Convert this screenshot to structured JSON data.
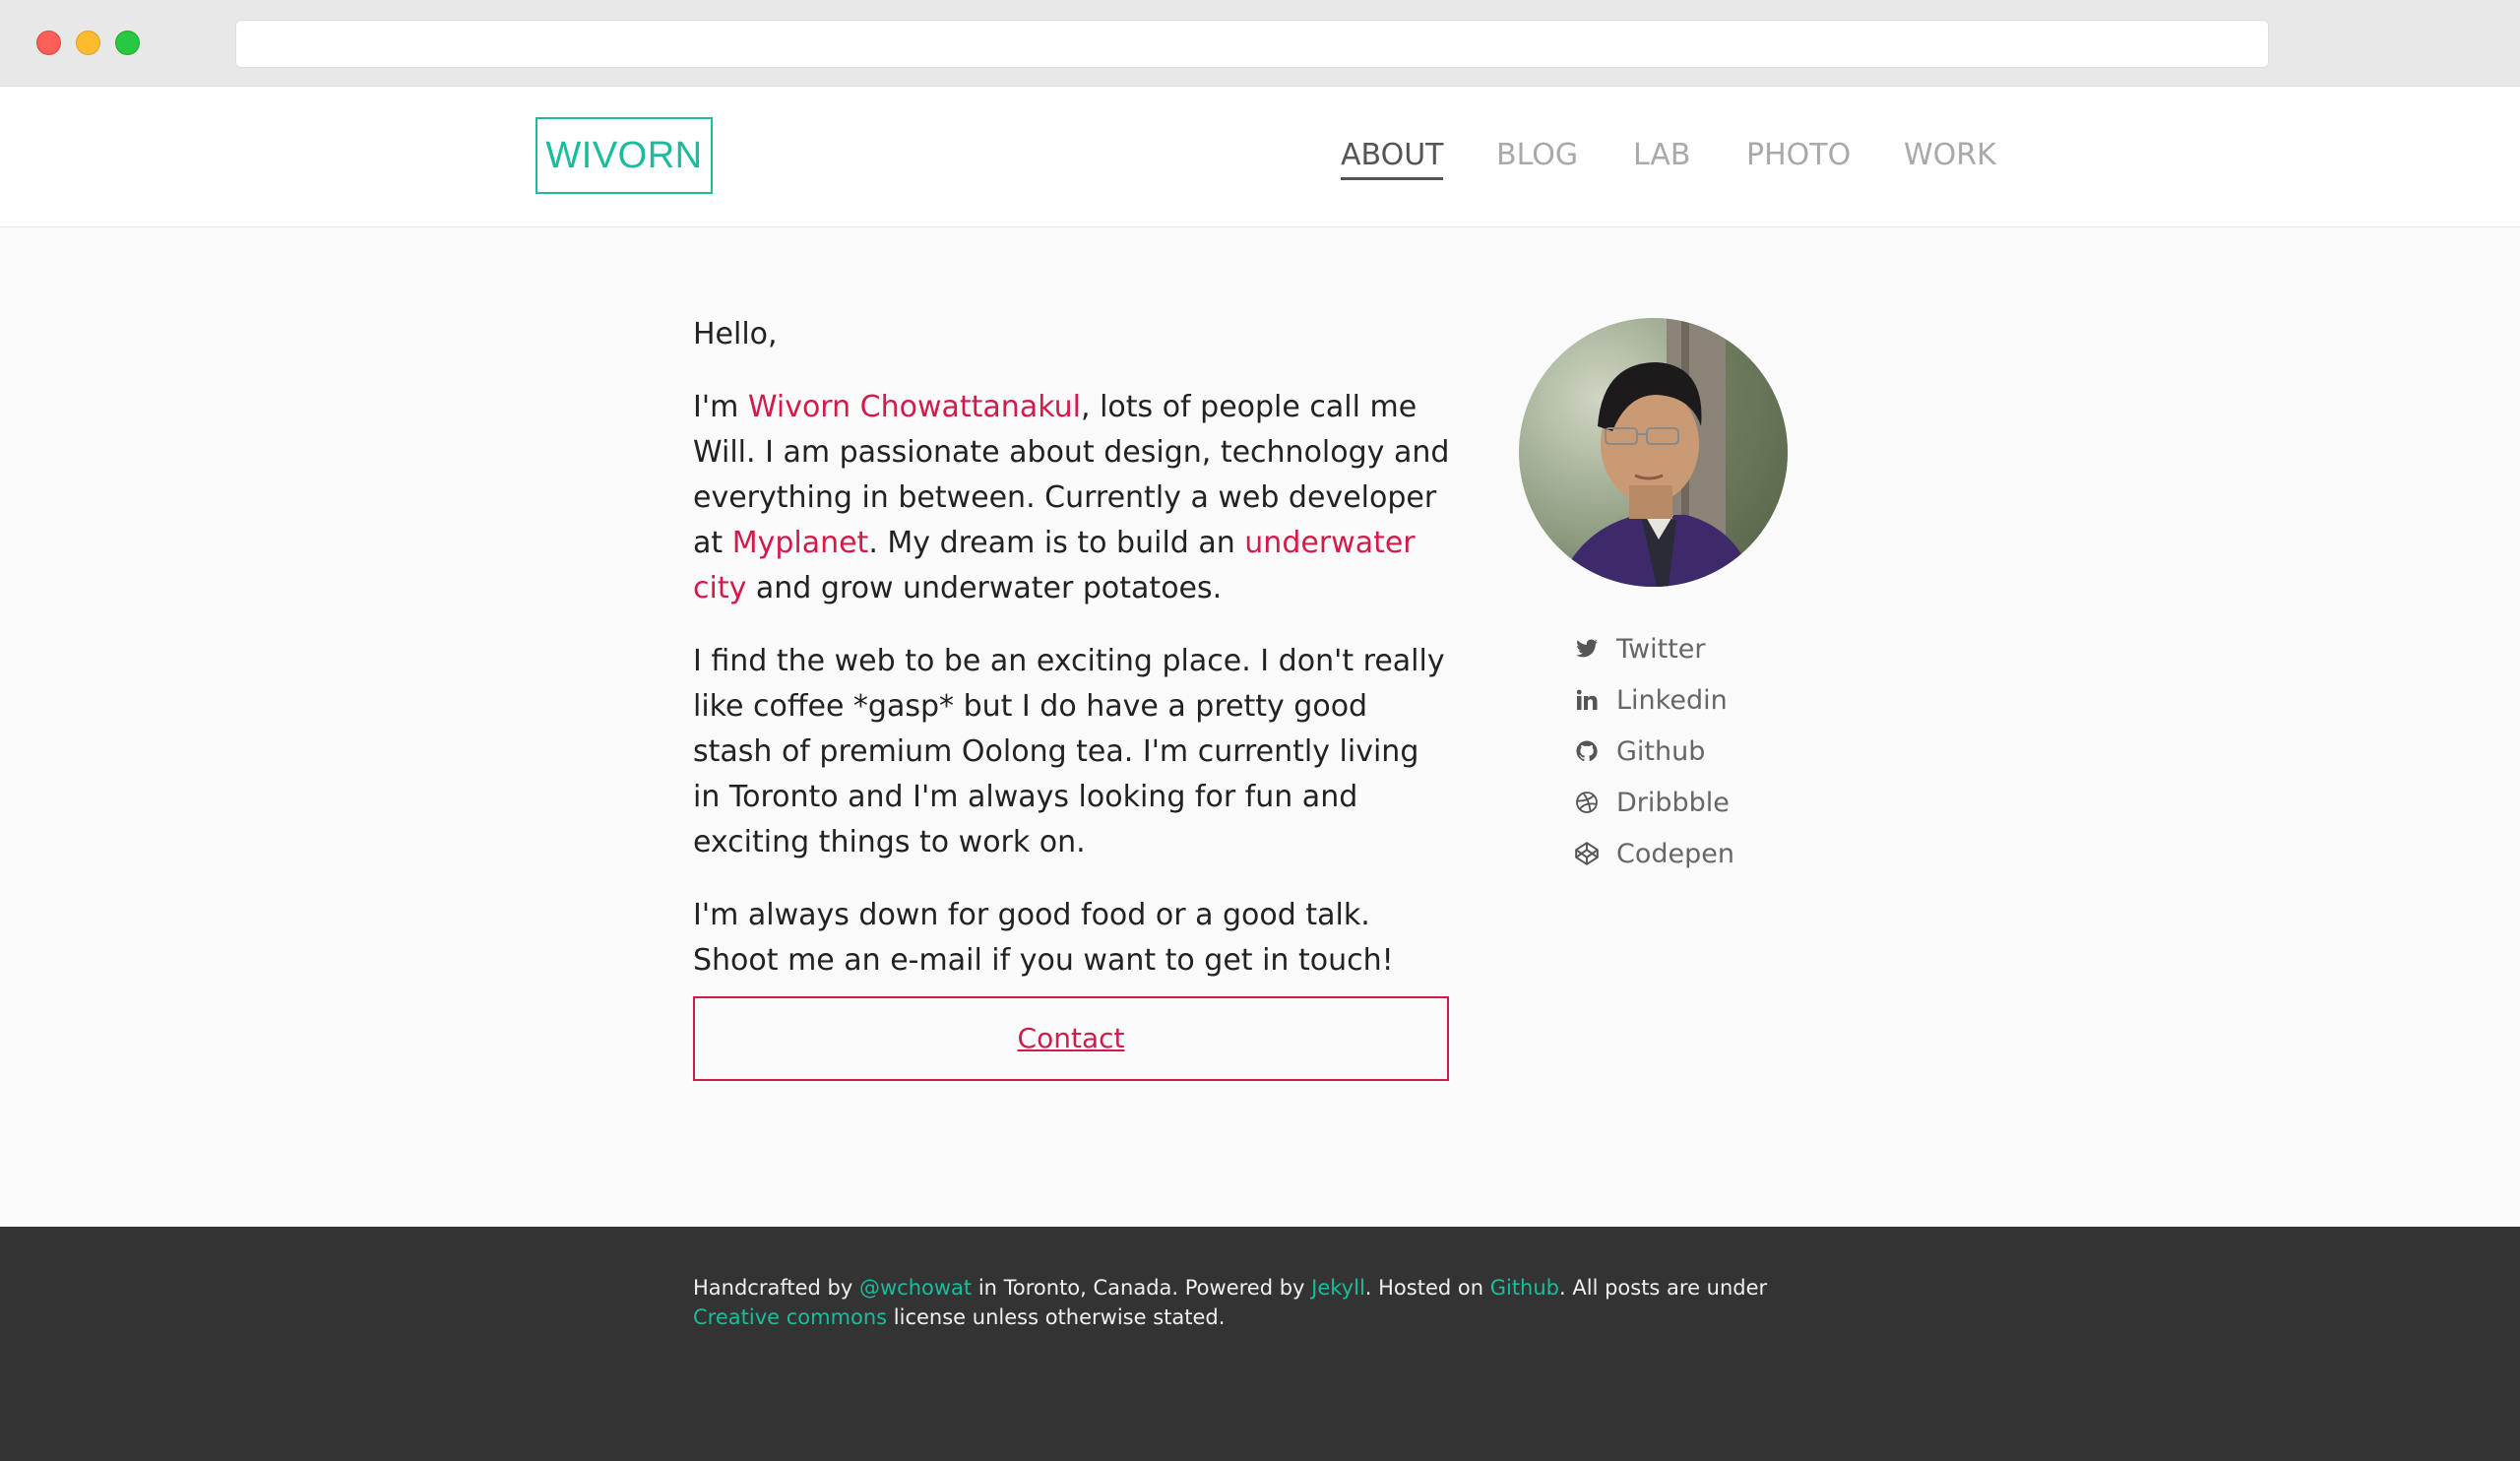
{
  "site": {
    "logo": "WIVORN",
    "nav": [
      {
        "label": "ABOUT",
        "active": true
      },
      {
        "label": "BLOG",
        "active": false
      },
      {
        "label": "LAB",
        "active": false
      },
      {
        "label": "PHOTO",
        "active": false
      },
      {
        "label": "WORK",
        "active": false
      }
    ]
  },
  "about": {
    "greeting": "Hello,",
    "p1": {
      "t1": "I'm ",
      "name_link": "Wivorn Chowattanakul",
      "t2": ", lots of people call me Will. I am passionate about design, technology and everything in between. Currently a web developer at ",
      "myplanet_link": "Myplanet",
      "t3": ". My dream is to build an ",
      "city_link": "underwater city",
      "t4": " and grow underwater potatoes."
    },
    "p2": "I find the web to be an exciting place. I don't really like coffee *gasp* but I do have a pretty good stash of premium Oolong tea. I'm currently living in Toronto and I'm always looking for fun and exciting things to work on.",
    "p3": "I'm always down for good food or a good talk. Shoot me an e-mail if you want to get in touch!",
    "contact_label": "Contact"
  },
  "social": [
    {
      "label": "Twitter",
      "icon": "twitter-icon"
    },
    {
      "label": "Linkedin",
      "icon": "linkedin-icon"
    },
    {
      "label": "Github",
      "icon": "github-icon"
    },
    {
      "label": "Dribbble",
      "icon": "dribbble-icon"
    },
    {
      "label": "Codepen",
      "icon": "codepen-icon"
    }
  ],
  "footer": {
    "t1": "Handcrafted by ",
    "handle_link": "@wchowat",
    "t2": " in Toronto, Canada. Powered by ",
    "jekyll_link": "Jekyll",
    "t3": ". Hosted on ",
    "github_link": "Github",
    "t4": ". All posts are under ",
    "cc_link": "Creative commons",
    "t5": " license unless otherwise stated."
  },
  "colors": {
    "accent_teal": "#1abc9c",
    "accent_red": "#d11c4b",
    "footer_bg": "#333333",
    "main_bg": "#fafafa"
  }
}
